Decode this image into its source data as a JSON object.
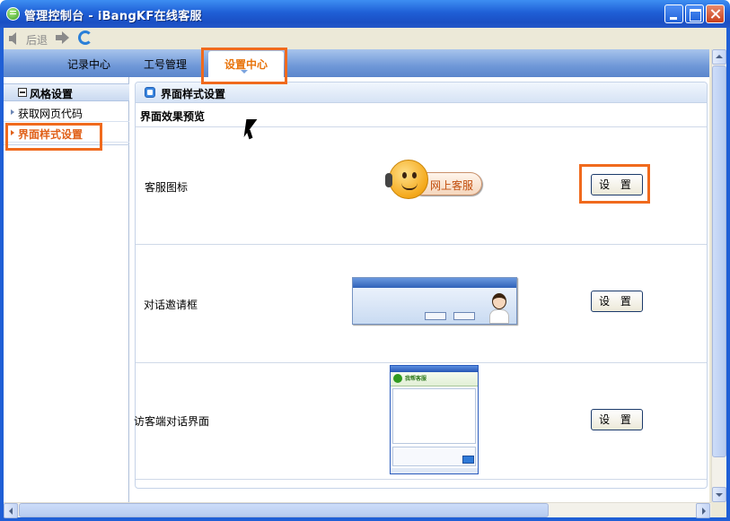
{
  "window": {
    "title": "管理控制台 - iBangKF在线客服"
  },
  "toolbar": {
    "back_label": "后退"
  },
  "nav": {
    "tabs": [
      {
        "label": "记录中心"
      },
      {
        "label": "工号管理"
      },
      {
        "label": "设置中心",
        "active": true
      }
    ]
  },
  "sidebar": {
    "section_title": "风格设置",
    "items": [
      {
        "label": "获取网页代码"
      },
      {
        "label": "界面样式设置",
        "active": true
      }
    ]
  },
  "panel": {
    "title": "界面样式设置",
    "preview_label": "界面效果预览",
    "rows": [
      {
        "label": "客服图标",
        "button": "设 置",
        "preview_text": "网上客服"
      },
      {
        "label": "对话邀请框",
        "button": "设 置"
      },
      {
        "label": "访客端对话界面",
        "button": "设 置",
        "preview_title": "我帮客服"
      }
    ]
  },
  "colors": {
    "accent": "#e8740c",
    "annotation": "#f06a1d",
    "titlebar": "#1f5fd6"
  },
  "icons": {
    "app": "app-logo-icon",
    "back": "back-arrow-icon",
    "forward": "forward-arrow-icon",
    "refresh": "refresh-icon"
  }
}
